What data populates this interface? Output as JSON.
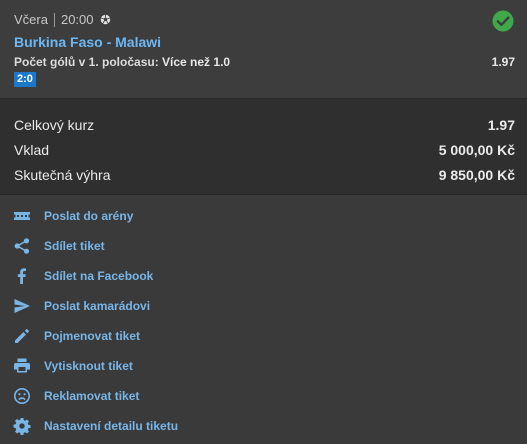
{
  "bet": {
    "day": "Včera",
    "time": "20:00",
    "match": "Burkina Faso - Malawi",
    "market_label": "Počet gólů v 1. poločasu: ",
    "market_pick": "Více než 1.0",
    "odds": "1.97",
    "score": "2:0",
    "status_color": "#3ea84a"
  },
  "summary": {
    "total_odds_label": "Celkový kurz",
    "total_odds_value": "1.97",
    "stake_label": "Vklad",
    "stake_value": "5 000,00 Kč",
    "win_label": "Skutečná výhra",
    "win_value": "9 850,00 Kč"
  },
  "actions": [
    {
      "label": "Poslat do arény",
      "icon": "arena-icon"
    },
    {
      "label": "Sdílet tiket",
      "icon": "share-icon"
    },
    {
      "label": "Sdílet na Facebook",
      "icon": "facebook-icon"
    },
    {
      "label": "Poslat kamarádovi",
      "icon": "send-icon"
    },
    {
      "label": "Pojmenovat tiket",
      "icon": "pencil-icon"
    },
    {
      "label": "Vytisknout tiket",
      "icon": "printer-icon"
    },
    {
      "label": "Reklamovat tiket",
      "icon": "sad-face-icon"
    },
    {
      "label": "Nastavení detailu tiketu",
      "icon": "gear-icon"
    }
  ],
  "colors": {
    "accent": "#79b6e8",
    "title": "#6cb8f5",
    "badge": "#1c78c8"
  }
}
